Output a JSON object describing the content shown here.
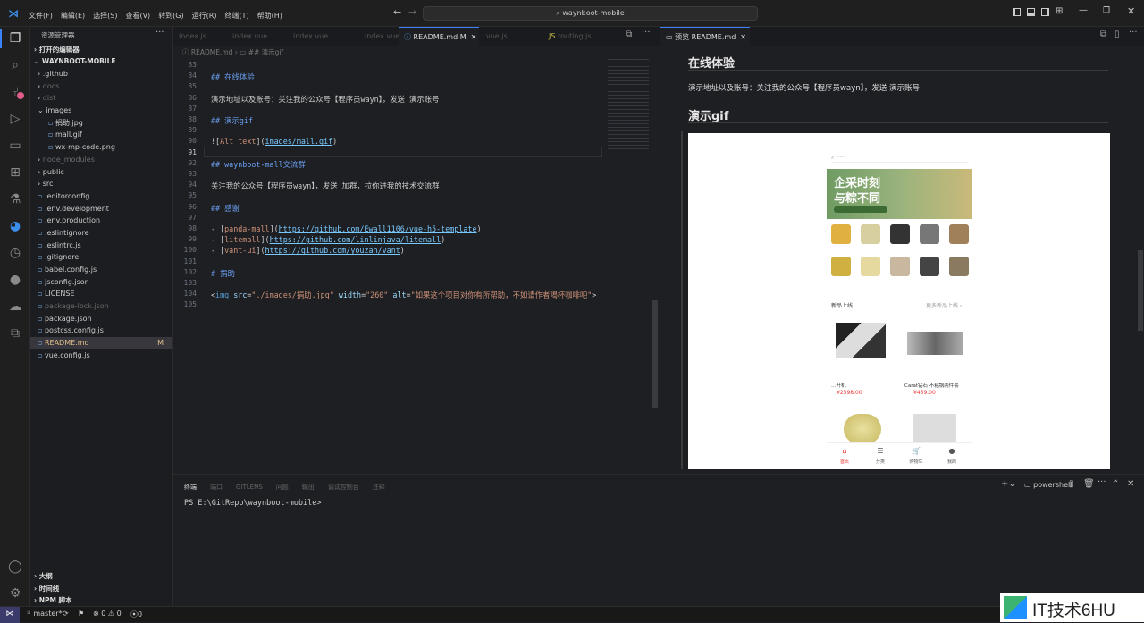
{
  "menu": [
    "文件(F)",
    "编辑(E)",
    "选择(S)",
    "查看(V)",
    "转到(G)",
    "运行(R)",
    "终端(T)",
    "帮助(H)"
  ],
  "search": {
    "value": "waynboot-mobile"
  },
  "sidebar": {
    "title": "资源管理器",
    "open_editors": "打开的编辑器",
    "project": "WAYNBOOT-MOBILE",
    "items": [
      {
        "label": ".github",
        "dim": false,
        "indent": 1,
        "type": "folder"
      },
      {
        "label": "docs",
        "dim": true,
        "indent": 1,
        "type": "folder"
      },
      {
        "label": "dist",
        "dim": true,
        "indent": 1,
        "type": "folder"
      },
      {
        "label": "images",
        "dim": false,
        "indent": 1,
        "type": "folder-open"
      },
      {
        "label": "捐助.jpg",
        "dim": false,
        "indent": 2,
        "type": "file"
      },
      {
        "label": "mall.gif",
        "dim": false,
        "indent": 2,
        "type": "file"
      },
      {
        "label": "wx-mp-code.png",
        "dim": false,
        "indent": 2,
        "type": "file"
      },
      {
        "label": "node_modules",
        "dim": true,
        "indent": 1,
        "type": "folder"
      },
      {
        "label": "public",
        "dim": false,
        "indent": 1,
        "type": "folder"
      },
      {
        "label": "src",
        "dim": false,
        "indent": 1,
        "type": "folder"
      },
      {
        "label": ".editorconfig",
        "dim": false,
        "indent": 1,
        "type": "file"
      },
      {
        "label": ".env.development",
        "dim": false,
        "indent": 1,
        "type": "file"
      },
      {
        "label": ".env.production",
        "dim": false,
        "indent": 1,
        "type": "file"
      },
      {
        "label": ".eslintignore",
        "dim": false,
        "indent": 1,
        "type": "file"
      },
      {
        "label": ".eslintrc.js",
        "dim": false,
        "indent": 1,
        "type": "file"
      },
      {
        "label": ".gitignore",
        "dim": false,
        "indent": 1,
        "type": "file"
      },
      {
        "label": "babel.config.js",
        "dim": false,
        "indent": 1,
        "type": "file"
      },
      {
        "label": "jsconfig.json",
        "dim": false,
        "indent": 1,
        "type": "file"
      },
      {
        "label": "LICENSE",
        "dim": false,
        "indent": 1,
        "type": "file"
      },
      {
        "label": "package-lock.json",
        "dim": true,
        "indent": 1,
        "type": "file"
      },
      {
        "label": "package.json",
        "dim": false,
        "indent": 1,
        "type": "file"
      },
      {
        "label": "postcss.config.js",
        "dim": false,
        "indent": 1,
        "type": "file"
      },
      {
        "label": "README.md",
        "dim": false,
        "indent": 1,
        "type": "file",
        "selected": true,
        "badge": "M"
      },
      {
        "label": "vue.config.js",
        "dim": false,
        "indent": 1,
        "type": "file"
      }
    ],
    "bottom": [
      "大纲",
      "时间线",
      "NPM 脚本"
    ]
  },
  "editor": {
    "active_tab": "README.md M",
    "breadcrumb": [
      "README.md",
      "## 演示gif"
    ],
    "lines": [
      {
        "n": "83",
        "html": ""
      },
      {
        "n": "84",
        "html": "<span class='h'>## 在线体验</span>"
      },
      {
        "n": "85",
        "html": ""
      },
      {
        "n": "86",
        "html": "演示地址以及账号：关注我的公众号【程序员wayn】，发送 演示账号"
      },
      {
        "n": "87",
        "html": ""
      },
      {
        "n": "88",
        "html": "<span class='h'>## 演示gif</span>"
      },
      {
        "n": "89",
        "html": ""
      },
      {
        "n": "90",
        "html": "![<span class='s'>Alt text</span>](<span class='u'>images/mall.gif</span>)"
      },
      {
        "n": "91",
        "html": ""
      },
      {
        "n": "92",
        "html": "<span class='h'>## waynboot-mall交流群</span>"
      },
      {
        "n": "93",
        "html": ""
      },
      {
        "n": "94",
        "html": "关注我的公众号【程序员wayn】，发送 加群，拉你进我的技术交流群"
      },
      {
        "n": "95",
        "html": ""
      },
      {
        "n": "96",
        "html": "<span class='h'>## 感谢</span>"
      },
      {
        "n": "97",
        "html": ""
      },
      {
        "n": "98",
        "html": "- [<span class='s'>panda-mall</span>](<span class='u'>https://github.com/Ewall1106/vue-h5-template</span>)"
      },
      {
        "n": "99",
        "html": "- [<span class='s'>litemall</span>](<span class='u'>https://github.com/linlinjava/litemall</span>)"
      },
      {
        "n": "100",
        "html": "- [<span class='s'>vant-ui</span>](<span class='u'>https://github.com/youzan/vant</span>)"
      },
      {
        "n": "101",
        "html": ""
      },
      {
        "n": "102",
        "html": "<span class='h'># 捐助</span>"
      },
      {
        "n": "103",
        "html": ""
      },
      {
        "n": "104",
        "html": "&lt;<span class='tagc'>img</span> <span class='attr'>src</span>=<span class='s'>\"./images/捐助.jpg\"</span> <span class='attr'>width</span>=<span class='s'>\"260\"</span> <span class='attr'>alt</span>=<span class='s'>\"如果这个项目对你有所帮助，不如请作者喝杯咖啡吧\"</span>&gt;"
      },
      {
        "n": "105",
        "html": ""
      }
    ]
  },
  "preview": {
    "tab": "预览 README.md",
    "h1": "在线体验",
    "p1": "演示地址以及账号：关注我的公众号【程序员wayn】，发送 演示账号",
    "h2": "演示gif",
    "phone": {
      "banner_line1": "企采时刻",
      "banner_line2": "与粽不同",
      "section": "新品上线",
      "more": "更多新品上线 ›",
      "prod1_name": "…开机",
      "prod1_price": "¥2598.00",
      "prod2_name": "Carat钻石 不粘锅两件套",
      "prod2_price": "¥459.00",
      "nav": [
        "首页",
        "分类",
        "购物车",
        "我的"
      ]
    }
  },
  "panel": {
    "tabs": [
      "终端",
      "端口",
      "GITLENS",
      "问题",
      "输出",
      "调试控制台",
      "注释"
    ],
    "shell": "powershell",
    "prompt": "PS E:\\GitRepo\\waynboot-mobile>"
  },
  "status": {
    "branch": "master*",
    "errors": "⊗ 0 ⚠ 0",
    "ports": "0"
  },
  "watermark": "IT技术6HU"
}
